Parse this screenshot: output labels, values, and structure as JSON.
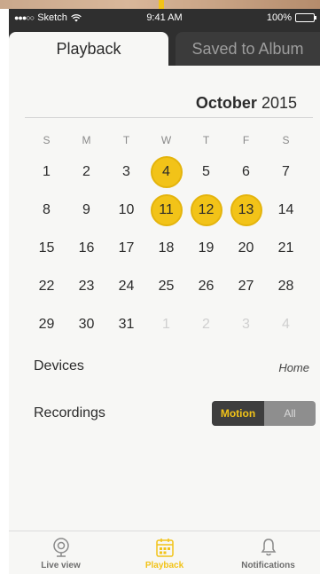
{
  "status_bar": {
    "carrier": "Sketch",
    "time": "9:41 AM",
    "battery": "100%",
    "battery_level": 1.0
  },
  "tabs": [
    {
      "label": "Playback",
      "active": true
    },
    {
      "label": "Saved to Album",
      "active": false
    }
  ],
  "calendar": {
    "month": "October",
    "year": "2015",
    "weekdays": [
      "S",
      "M",
      "T",
      "W",
      "T",
      "F",
      "S"
    ],
    "weeks": [
      [
        {
          "d": "1"
        },
        {
          "d": "2"
        },
        {
          "d": "3"
        },
        {
          "d": "4",
          "highlight": true
        },
        {
          "d": "5"
        },
        {
          "d": "6"
        },
        {
          "d": "7"
        }
      ],
      [
        {
          "d": "8"
        },
        {
          "d": "9"
        },
        {
          "d": "10"
        },
        {
          "d": "11",
          "highlight": true
        },
        {
          "d": "12",
          "highlight": true
        },
        {
          "d": "13",
          "highlight": true
        },
        {
          "d": "14"
        }
      ],
      [
        {
          "d": "15"
        },
        {
          "d": "16"
        },
        {
          "d": "17"
        },
        {
          "d": "18"
        },
        {
          "d": "19"
        },
        {
          "d": "20"
        },
        {
          "d": "21"
        }
      ],
      [
        {
          "d": "22"
        },
        {
          "d": "23"
        },
        {
          "d": "24"
        },
        {
          "d": "25"
        },
        {
          "d": "26"
        },
        {
          "d": "27"
        },
        {
          "d": "28"
        }
      ],
      [
        {
          "d": "29"
        },
        {
          "d": "30"
        },
        {
          "d": "31"
        },
        {
          "d": "1",
          "muted": true
        },
        {
          "d": "2",
          "muted": true
        },
        {
          "d": "3",
          "muted": true
        },
        {
          "d": "4",
          "muted": true
        }
      ]
    ]
  },
  "devices": {
    "label": "Devices",
    "value": "Home"
  },
  "recordings": {
    "label": "Recordings",
    "options": [
      "Motion",
      "All"
    ],
    "selected": "Motion"
  },
  "bottom_nav": [
    {
      "label": "Live view",
      "icon": "webcam-icon",
      "active": false
    },
    {
      "label": "Playback",
      "icon": "calendar-icon",
      "active": true
    },
    {
      "label": "Notifications",
      "icon": "bell-icon",
      "active": false
    }
  ],
  "colors": {
    "accent": "#f2c318",
    "dark": "#2f2f2f",
    "background": "#f7f7f5"
  }
}
